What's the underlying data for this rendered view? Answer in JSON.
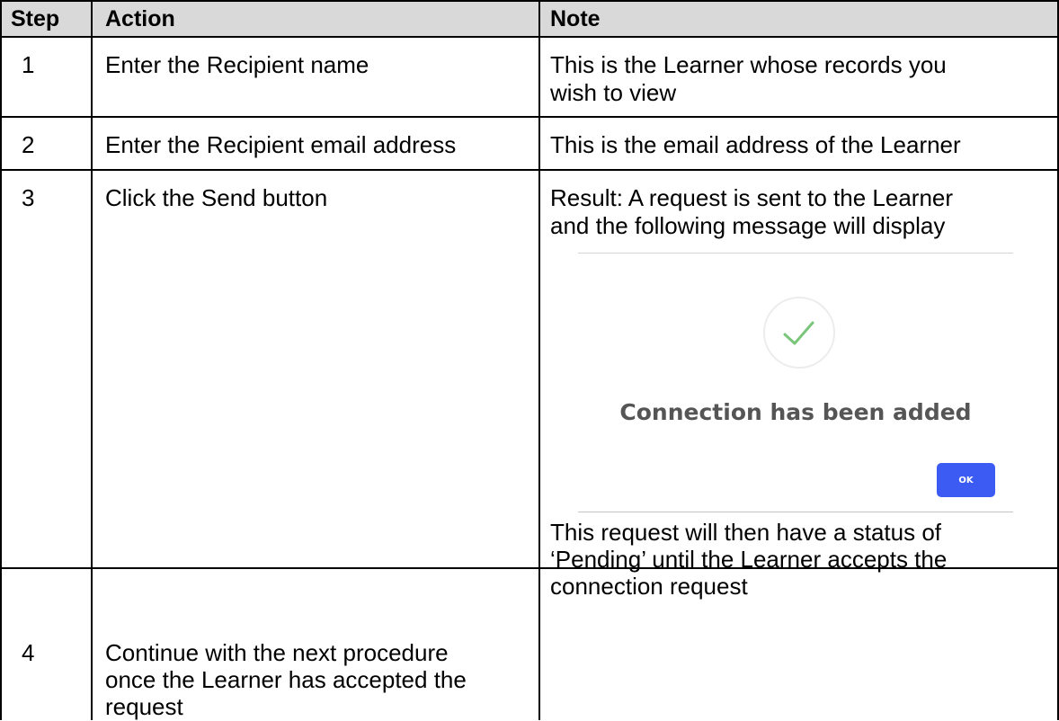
{
  "table": {
    "headers": {
      "step": "Step",
      "action": "Action",
      "note": "Note"
    },
    "rows": [
      {
        "step": "1",
        "action": "Enter the Recipient name",
        "note_lines": [
          "This is the Learner whose records you",
          "wish to view"
        ]
      },
      {
        "step": "2",
        "action": "Enter the Recipient email address",
        "note_lines": [
          "This is the email address of the Learner"
        ]
      },
      {
        "step": "3",
        "action": "Click the Send button",
        "note_lines": [
          "Result: A request is sent to the Learner",
          "and the following message will display"
        ],
        "note_after_lines": [
          "This request will then have a status of",
          "‘Pending’ until the Learner accepts the",
          "connection request"
        ]
      },
      {
        "step": "4",
        "action_lines": [
          "Continue with the next procedure",
          "once the Learner has accepted the",
          "request"
        ],
        "note_lines": []
      }
    ]
  },
  "dialog": {
    "icon": "check-circle-icon",
    "message": "Connection has been added",
    "ok_label": "OK",
    "colors": {
      "check": "#79c57a",
      "button": "#3b5bf3",
      "message": "#555555"
    }
  }
}
